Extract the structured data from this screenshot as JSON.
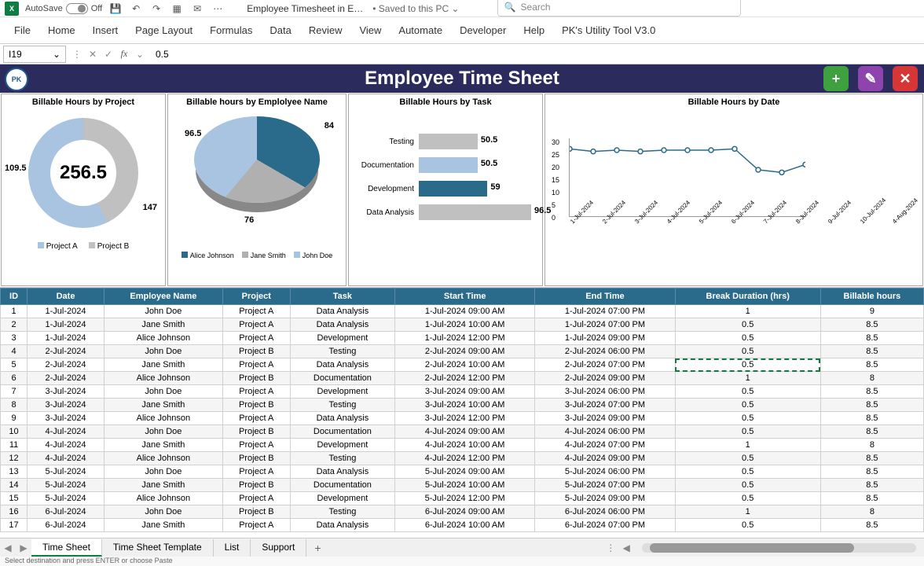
{
  "titlebar": {
    "autosave_label": "AutoSave",
    "autosave_state": "Off",
    "doc_name": "Employee Timesheet in E…",
    "saved_state": "• Saved to this PC",
    "search_placeholder": "Search"
  },
  "ribbon": {
    "tabs": [
      "File",
      "Home",
      "Insert",
      "Page Layout",
      "Formulas",
      "Data",
      "Review",
      "View",
      "Automate",
      "Developer",
      "Help",
      "PK's Utility Tool V3.0"
    ]
  },
  "formula_bar": {
    "name_box": "I19",
    "formula": "0.5"
  },
  "dashboard": {
    "title": "Employee Time Sheet"
  },
  "chart_data": [
    {
      "type": "pie",
      "title": "Billable Hours by Project",
      "categories": [
        "Project A",
        "Project B"
      ],
      "values": [
        109.5,
        147
      ],
      "center_total": "256.5",
      "colors": [
        "#a8c4e0",
        "#c0c0c0"
      ]
    },
    {
      "type": "pie",
      "title": "Billable hours by Emplolyee Name",
      "categories": [
        "Alice Johnson",
        "Jane Smith",
        "John Doe"
      ],
      "values": [
        96.5,
        76,
        84
      ],
      "colors": [
        "#2a6a8a",
        "#b0b0b0",
        "#a8c4e0"
      ]
    },
    {
      "type": "bar",
      "title": "Billable Hours by Task",
      "categories": [
        "Testing",
        "Documentation",
        "Development",
        "Data Analysis"
      ],
      "values": [
        50.5,
        50.5,
        59,
        96.5
      ],
      "colors": [
        "#c0c0c0",
        "#a8c4e0",
        "#2a6a8a",
        "#c0c0c0"
      ]
    },
    {
      "type": "line",
      "title": "Billable Hours by Date",
      "x": [
        "1-Jul-2024",
        "2-Jul-2024",
        "3-Jul-2024",
        "4-Jul-2024",
        "5-Jul-2024",
        "6-Jul-2024",
        "7-Jul-2024",
        "8-Jul-2024",
        "9-Jul-2024",
        "10-Jul-2024",
        "4-Aug-2024"
      ],
      "values": [
        26,
        25,
        25.5,
        25,
        25.5,
        25.5,
        25.5,
        26,
        18,
        17,
        20
      ],
      "ylim": [
        0,
        30
      ],
      "yticks": [
        0,
        5,
        10,
        15,
        20,
        25,
        30
      ]
    }
  ],
  "table": {
    "headers": [
      "ID",
      "Date",
      "Employee Name",
      "Project",
      "Task",
      "Start Time",
      "End Time",
      "Break Duration (hrs)",
      "Billable hours"
    ],
    "rows": [
      [
        "1",
        "1-Jul-2024",
        "John Doe",
        "Project A",
        "Data Analysis",
        "1-Jul-2024 09:00 AM",
        "1-Jul-2024 07:00 PM",
        "1",
        "9"
      ],
      [
        "2",
        "1-Jul-2024",
        "Jane Smith",
        "Project A",
        "Data Analysis",
        "1-Jul-2024 10:00 AM",
        "1-Jul-2024 07:00 PM",
        "0.5",
        "8.5"
      ],
      [
        "3",
        "1-Jul-2024",
        "Alice Johnson",
        "Project A",
        "Development",
        "1-Jul-2024 12:00 PM",
        "1-Jul-2024 09:00 PM",
        "0.5",
        "8.5"
      ],
      [
        "4",
        "2-Jul-2024",
        "John Doe",
        "Project B",
        "Testing",
        "2-Jul-2024 09:00 AM",
        "2-Jul-2024 06:00 PM",
        "0.5",
        "8.5"
      ],
      [
        "5",
        "2-Jul-2024",
        "Jane Smith",
        "Project A",
        "Data Analysis",
        "2-Jul-2024 10:00 AM",
        "2-Jul-2024 07:00 PM",
        "0.5",
        "8.5"
      ],
      [
        "6",
        "2-Jul-2024",
        "Alice Johnson",
        "Project B",
        "Documentation",
        "2-Jul-2024 12:00 PM",
        "2-Jul-2024 09:00 PM",
        "1",
        "8"
      ],
      [
        "7",
        "3-Jul-2024",
        "John Doe",
        "Project A",
        "Development",
        "3-Jul-2024 09:00 AM",
        "3-Jul-2024 06:00 PM",
        "0.5",
        "8.5"
      ],
      [
        "8",
        "3-Jul-2024",
        "Jane Smith",
        "Project B",
        "Testing",
        "3-Jul-2024 10:00 AM",
        "3-Jul-2024 07:00 PM",
        "0.5",
        "8.5"
      ],
      [
        "9",
        "3-Jul-2024",
        "Alice Johnson",
        "Project A",
        "Data Analysis",
        "3-Jul-2024 12:00 PM",
        "3-Jul-2024 09:00 PM",
        "0.5",
        "8.5"
      ],
      [
        "10",
        "4-Jul-2024",
        "John Doe",
        "Project B",
        "Documentation",
        "4-Jul-2024 09:00 AM",
        "4-Jul-2024 06:00 PM",
        "0.5",
        "8.5"
      ],
      [
        "11",
        "4-Jul-2024",
        "Jane Smith",
        "Project A",
        "Development",
        "4-Jul-2024 10:00 AM",
        "4-Jul-2024 07:00 PM",
        "1",
        "8"
      ],
      [
        "12",
        "4-Jul-2024",
        "Alice Johnson",
        "Project B",
        "Testing",
        "4-Jul-2024 12:00 PM",
        "4-Jul-2024 09:00 PM",
        "0.5",
        "8.5"
      ],
      [
        "13",
        "5-Jul-2024",
        "John Doe",
        "Project A",
        "Data Analysis",
        "5-Jul-2024 09:00 AM",
        "5-Jul-2024 06:00 PM",
        "0.5",
        "8.5"
      ],
      [
        "14",
        "5-Jul-2024",
        "Jane Smith",
        "Project B",
        "Documentation",
        "5-Jul-2024 10:00 AM",
        "5-Jul-2024 07:00 PM",
        "0.5",
        "8.5"
      ],
      [
        "15",
        "5-Jul-2024",
        "Alice Johnson",
        "Project A",
        "Development",
        "5-Jul-2024 12:00 PM",
        "5-Jul-2024 09:00 PM",
        "0.5",
        "8.5"
      ],
      [
        "16",
        "6-Jul-2024",
        "John Doe",
        "Project B",
        "Testing",
        "6-Jul-2024 09:00 AM",
        "6-Jul-2024 06:00 PM",
        "1",
        "8"
      ],
      [
        "17",
        "6-Jul-2024",
        "Jane Smith",
        "Project A",
        "Data Analysis",
        "6-Jul-2024 10:00 AM",
        "6-Jul-2024 07:00 PM",
        "0.5",
        "8.5"
      ]
    ],
    "selected_cell": [
      4,
      7
    ]
  },
  "sheet_tabs": {
    "tabs": [
      "Time Sheet",
      "Time Sheet Template",
      "List",
      "Support"
    ],
    "active": 0
  },
  "status_bar": "Select destination and press ENTER or choose Paste"
}
